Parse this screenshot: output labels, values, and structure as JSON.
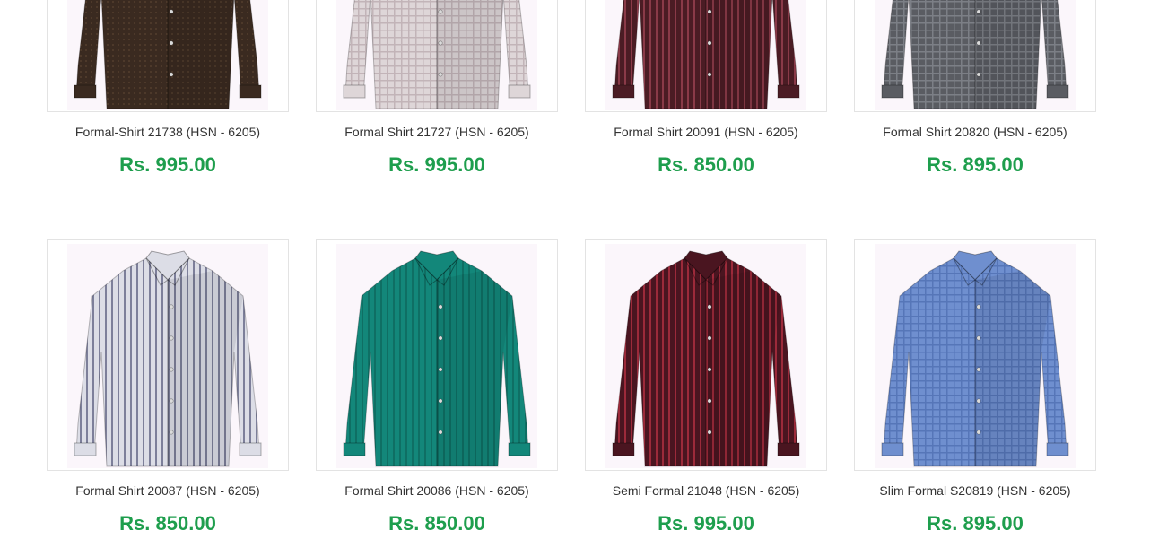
{
  "theme": {
    "price_color": "#1e9e4d",
    "border_color": "#e3e3e3"
  },
  "products": [
    {
      "name": "Formal-Shirt 21738 (HSN - 6205)",
      "price": "Rs. 995.00",
      "shirt_color": "#3a2a20",
      "pattern_color": "#5a4330",
      "pattern": "dots",
      "image_icon": "shirt-icon"
    },
    {
      "name": "Formal Shirt 21727 (HSN - 6205)",
      "price": "Rs. 995.00",
      "shirt_color": "#ded6d8",
      "pattern_color": "#c2b4b8",
      "pattern": "check",
      "image_icon": "shirt-icon"
    },
    {
      "name": "Formal Shirt 20091 (HSN - 6205)",
      "price": "Rs. 850.00",
      "shirt_color": "#4b1c24",
      "pattern_color": "#8a3a48",
      "pattern": "stripes",
      "image_icon": "shirt-icon"
    },
    {
      "name": "Formal Shirt 20820 (HSN - 6205)",
      "price": "Rs. 895.00",
      "shirt_color": "#5a5c62",
      "pattern_color": "#7c7f86",
      "pattern": "check",
      "image_icon": "shirt-icon"
    },
    {
      "name": "Formal Shirt 20087 (HSN - 6205)",
      "price": "Rs. 850.00",
      "shirt_color": "#dcdde6",
      "pattern_color": "#7d7f9a",
      "pattern": "stripes",
      "image_icon": "shirt-icon"
    },
    {
      "name": "Formal Shirt 20086 (HSN - 6205)",
      "price": "Rs. 850.00",
      "shirt_color": "#13877a",
      "pattern_color": "#0f6f64",
      "pattern": "stripes",
      "image_icon": "shirt-icon"
    },
    {
      "name": "Semi Formal 21048 (HSN - 6205)",
      "price": "Rs. 995.00",
      "shirt_color": "#4a1520",
      "pattern_color": "#9c2a3a",
      "pattern": "stripes",
      "image_icon": "shirt-icon"
    },
    {
      "name": "Slim Formal S20819 (HSN - 6205)",
      "price": "Rs. 895.00",
      "shirt_color": "#6f8fcf",
      "pattern_color": "#5676b8",
      "pattern": "check",
      "image_icon": "shirt-icon"
    }
  ]
}
